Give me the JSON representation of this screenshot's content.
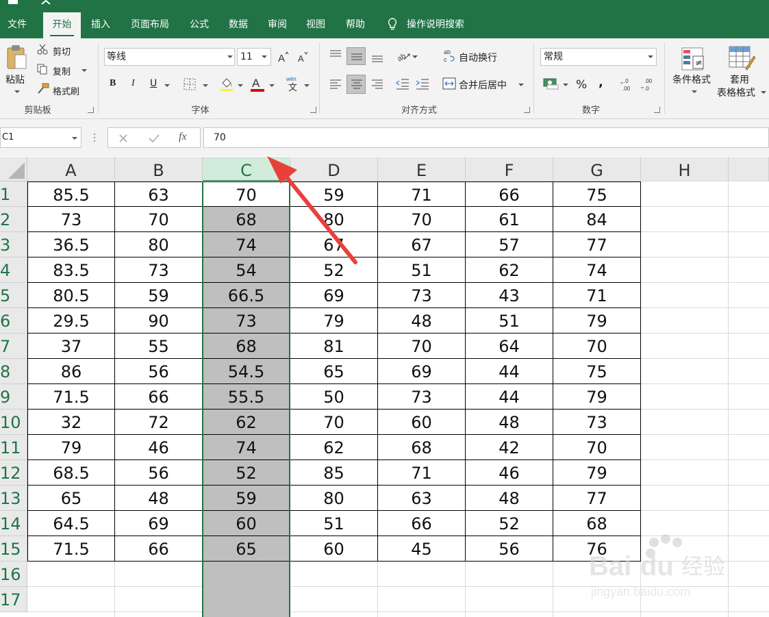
{
  "tabs": [
    "文件",
    "开始",
    "插入",
    "页面布局",
    "公式",
    "数据",
    "审阅",
    "视图",
    "帮助"
  ],
  "active_tab": "开始",
  "search_label": "操作说明搜索",
  "ribbon": {
    "clipboard": {
      "paste": "粘贴",
      "cut": "剪切",
      "copy": "复制",
      "format_painter": "格式刷",
      "group": "剪贴板"
    },
    "font": {
      "name": "等线",
      "size": "11",
      "bold": "B",
      "italic": "I",
      "underline": "U",
      "group": "字体",
      "phonetic": "wén"
    },
    "alignment": {
      "wrap": "自动换行",
      "merge": "合并后居中",
      "group": "对齐方式"
    },
    "number": {
      "format": "常规",
      "percent": "%",
      "comma": ",",
      "group": "数字"
    },
    "styles": {
      "conditional": "条件格式",
      "table_format_1": "套用",
      "table_format_2": "表格格式"
    }
  },
  "formula_bar": {
    "name_box": "C1",
    "fx": "fx",
    "value": "70"
  },
  "columns": [
    "A",
    "B",
    "C",
    "D",
    "E",
    "F",
    "G",
    "H"
  ],
  "selected_column": "C",
  "row_numbers": [
    "1",
    "2",
    "3",
    "4",
    "5",
    "6",
    "7",
    "8",
    "9",
    "10",
    "11",
    "12",
    "13",
    "14",
    "15",
    "16",
    "17"
  ],
  "rows": [
    [
      "85.5",
      "63",
      "70",
      "59",
      "71",
      "66",
      "75"
    ],
    [
      "73",
      "70",
      "68",
      "80",
      "70",
      "61",
      "84"
    ],
    [
      "36.5",
      "80",
      "74",
      "67",
      "67",
      "57",
      "77"
    ],
    [
      "83.5",
      "73",
      "54",
      "52",
      "51",
      "62",
      "74"
    ],
    [
      "80.5",
      "59",
      "66.5",
      "69",
      "73",
      "43",
      "71"
    ],
    [
      "29.5",
      "90",
      "73",
      "79",
      "48",
      "51",
      "79"
    ],
    [
      "37",
      "55",
      "68",
      "81",
      "70",
      "64",
      "70"
    ],
    [
      "86",
      "56",
      "54.5",
      "65",
      "69",
      "44",
      "75"
    ],
    [
      "71.5",
      "66",
      "55.5",
      "50",
      "73",
      "44",
      "79"
    ],
    [
      "32",
      "72",
      "62",
      "70",
      "60",
      "48",
      "73"
    ],
    [
      "79",
      "46",
      "74",
      "62",
      "68",
      "42",
      "70"
    ],
    [
      "68.5",
      "56",
      "52",
      "85",
      "71",
      "46",
      "79"
    ],
    [
      "65",
      "48",
      "59",
      "80",
      "63",
      "48",
      "77"
    ],
    [
      "64.5",
      "69",
      "60",
      "51",
      "66",
      "52",
      "68"
    ],
    [
      "71.5",
      "66",
      "65",
      "60",
      "45",
      "56",
      "76"
    ]
  ],
  "colors": {
    "accent": "#217346",
    "selection_fill": "#bfbfbf",
    "arrow": "#e8413c"
  },
  "watermark": "Baidu经验 jingyan.baidu.com"
}
